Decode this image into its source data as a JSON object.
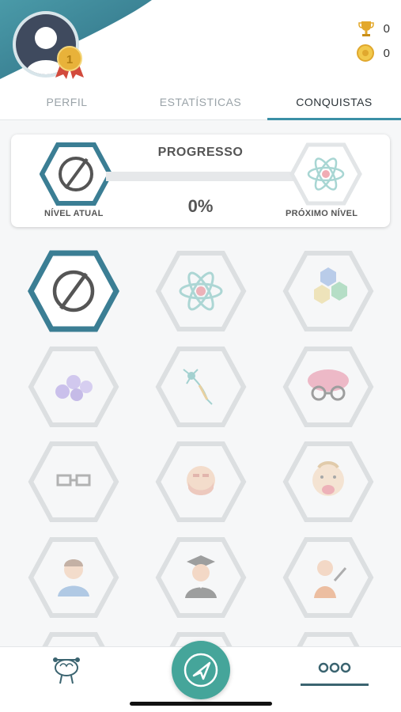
{
  "header": {
    "trophy_count": "0",
    "coin_count": "0",
    "medal_number": "1"
  },
  "tabs": [
    {
      "label": "PERFIL"
    },
    {
      "label": "ESTATÍSTICAS"
    },
    {
      "label": "CONQUISTAS"
    }
  ],
  "progress": {
    "title": "PROGRESSO",
    "percent": "0%",
    "percent_value": 0,
    "current_level_label": "NÍVEL ATUAL",
    "next_level_label": "PRÓXIMO NÍVEL"
  },
  "achievements": [
    {
      "icon": "empty-set-icon",
      "unlocked": true
    },
    {
      "icon": "atom-icon",
      "unlocked": false
    },
    {
      "icon": "molecule-icon",
      "unlocked": false
    },
    {
      "icon": "cells-icon",
      "unlocked": false
    },
    {
      "icon": "neuron-icon",
      "unlocked": false
    },
    {
      "icon": "brain-glasses-icon",
      "unlocked": false
    },
    {
      "icon": "glasses-icon",
      "unlocked": false
    },
    {
      "icon": "face-mask-icon",
      "unlocked": false
    },
    {
      "icon": "baby-icon",
      "unlocked": false
    },
    {
      "icon": "boy-icon",
      "unlocked": false
    },
    {
      "icon": "graduate-icon",
      "unlocked": false
    },
    {
      "icon": "teacher-icon",
      "unlocked": false
    }
  ],
  "colors": {
    "accent": "#3b8fa6",
    "nav_center": "#45a59a",
    "locked": "#d5d9dc"
  }
}
